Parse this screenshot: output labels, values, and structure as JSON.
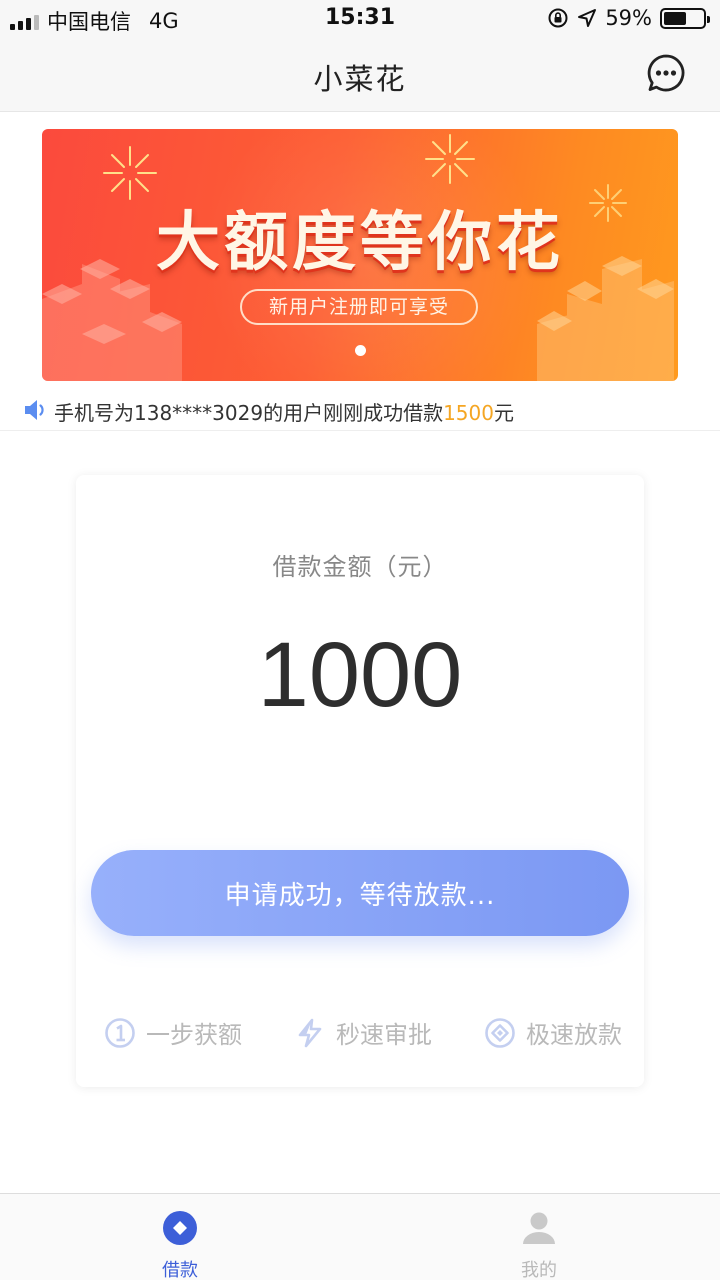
{
  "status_bar": {
    "carrier": "中国电信",
    "network": "4G",
    "time": "15:31",
    "battery": "59%",
    "battery_level": 0.59
  },
  "nav": {
    "title": "小菜花",
    "more_icon": "more-dots-icon"
  },
  "banner": {
    "headline": "大额度等你花",
    "subtitle": "新用户注册即可享受",
    "colors": {
      "start": "#fb4a3d",
      "end": "#ff9a1e"
    }
  },
  "notice": {
    "icon": "speaker-icon",
    "text_before": "手机号为138****3029的用户刚刚成功借款",
    "amount": "1500",
    "text_after": "元",
    "amount_color": "#f5a623"
  },
  "loan": {
    "label": "借款金额（元）",
    "amount": "1000",
    "button_label": "申请成功，等待放款..."
  },
  "features": [
    {
      "icon": "circle-one-icon",
      "label": "一步获额"
    },
    {
      "icon": "lightning-icon",
      "label": "秒速审批"
    },
    {
      "icon": "diamond-coin-icon",
      "label": "极速放款"
    }
  ],
  "tabs": [
    {
      "icon": "loan-diamond-icon",
      "label": "借款",
      "active": true
    },
    {
      "icon": "user-icon",
      "label": "我的",
      "active": false
    }
  ],
  "colors": {
    "accent": "#3d5fd8",
    "button_start": "#97b0fb",
    "button_end": "#7b98f3"
  }
}
